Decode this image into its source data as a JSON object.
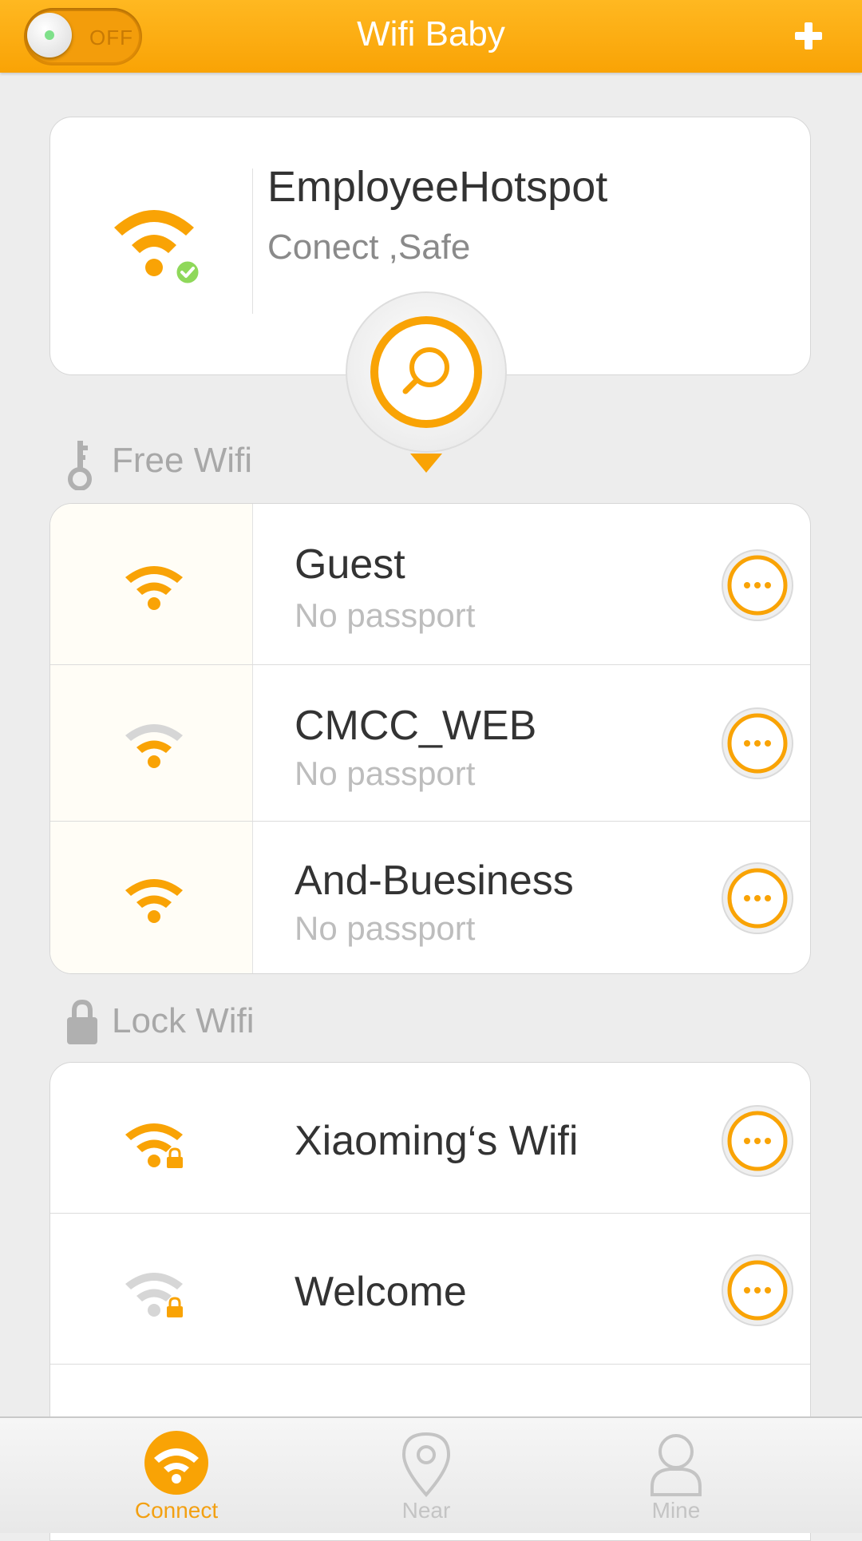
{
  "header": {
    "title": "Wifi Baby",
    "toggle_label": "OFF",
    "add_icon": "plus-icon"
  },
  "current": {
    "name": "EmployeeHotspot",
    "status": "Conect ,Safe",
    "icon": "wifi-connected-icon"
  },
  "search": {
    "icon": "search-icon"
  },
  "free_section": {
    "label": "Free Wifi",
    "icon": "key-icon",
    "items": [
      {
        "name": "Guest",
        "sub": "No passport",
        "signal": "strong"
      },
      {
        "name": "CMCC_WEB",
        "sub": "No passport",
        "signal": "weak"
      },
      {
        "name": "And-Buesiness",
        "sub": "No passport",
        "signal": "strong"
      }
    ]
  },
  "lock_section": {
    "label": "Lock Wifi",
    "icon": "lock-icon",
    "items": [
      {
        "name": "Xiaoming‘s Wifi",
        "signal": "strong"
      },
      {
        "name": "Welcome",
        "signal": "weak"
      }
    ]
  },
  "tabs": [
    {
      "label": "Connect",
      "icon": "wifi-icon",
      "active": true
    },
    {
      "label": "Near",
      "icon": "location-pin-icon",
      "active": false
    },
    {
      "label": "Mine",
      "icon": "user-icon",
      "active": false
    }
  ],
  "colors": {
    "accent": "#f9a305",
    "header_top": "#ffb821",
    "wifi_inactive": "#d6d6d6",
    "check_green": "#8fd85a"
  }
}
